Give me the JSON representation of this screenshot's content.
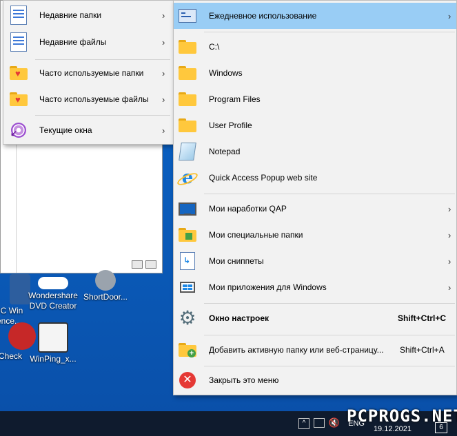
{
  "colors": {
    "highlight": "#99cdf5",
    "menu_bg": "#f2f2f2",
    "desktop": "#0a5ab8",
    "taskbar": "#0f1b2e"
  },
  "left_menu": {
    "items": [
      {
        "label": "Недавние папки",
        "icon": "recent-folders-icon"
      },
      {
        "label": "Недавние файлы",
        "icon": "recent-files-icon"
      },
      {
        "label": "Часто используемые папки",
        "icon": "heart-folder-icon"
      },
      {
        "label": "Часто используемые файлы",
        "icon": "heart-folder-icon"
      },
      {
        "label": "Текущие окна",
        "icon": "windows-target-icon"
      }
    ]
  },
  "right_menu": {
    "items": [
      {
        "label": "Ежедневное использование",
        "icon": "daily-use-icon",
        "submenu": true
      },
      {
        "label": "C:\\",
        "icon": "folder-icon"
      },
      {
        "label": "Windows",
        "icon": "folder-icon"
      },
      {
        "label": "Program Files",
        "icon": "folder-icon"
      },
      {
        "label": "User Profile",
        "icon": "folder-icon"
      },
      {
        "label": "Notepad",
        "icon": "notepad-icon"
      },
      {
        "label": "Quick Access Popup web site",
        "icon": "internet-explorer-icon"
      },
      {
        "label": "Мои наработки QAP",
        "icon": "monitor-icon",
        "submenu": true
      },
      {
        "label": "Мои специальные папки",
        "icon": "puzzle-folder-icon",
        "submenu": true
      },
      {
        "label": "Мои сниппеты",
        "icon": "snippet-icon",
        "submenu": true
      },
      {
        "label": "Мои приложения для Windows",
        "icon": "windows-apps-icon",
        "submenu": true
      },
      {
        "label": "Окно настроек",
        "icon": "gear-icon",
        "shortcut": "Shift+Ctrl+C"
      },
      {
        "label": "Добавить активную папку или веб-страницу...",
        "icon": "add-folder-icon",
        "shortcut": "Shift+Ctrl+A"
      },
      {
        "label": "Закрыть это меню",
        "icon": "close-icon"
      }
    ]
  },
  "desktop_icons": [
    {
      "label_line1": "PC Win",
      "label_line2": "ence..."
    },
    {
      "label_line1": "Wondershare",
      "label_line2": "DVD Creator"
    },
    {
      "label_line1": "ShortDoor...",
      "label_line2": ""
    },
    {
      "label_line1": "Check",
      "label_line2": ""
    },
    {
      "label_line1": "WinPing_x...",
      "label_line2": ""
    }
  ],
  "taskbar": {
    "lang": "ENG",
    "date": "19.12.2021",
    "notifications": "6"
  },
  "watermark": "PCPROGS.NET"
}
